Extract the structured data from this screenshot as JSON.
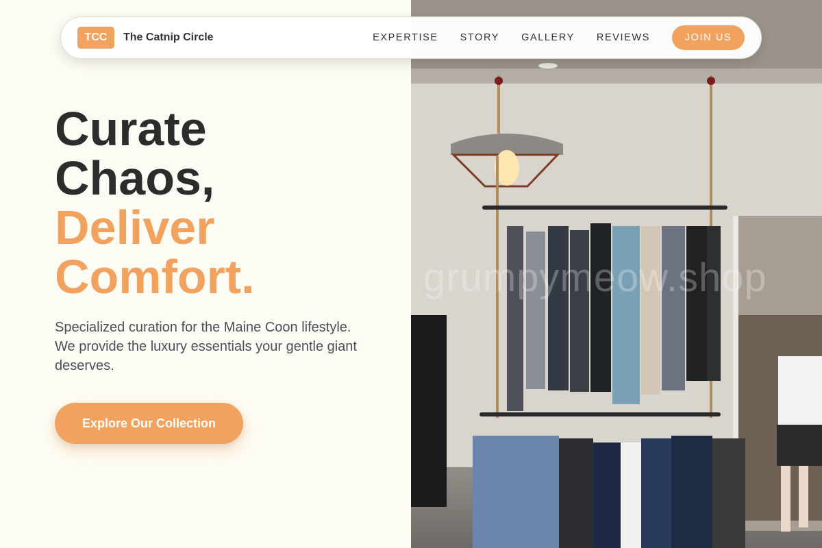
{
  "brand": {
    "badge": "TCC",
    "name": "The Catnip Circle"
  },
  "nav": {
    "links": [
      "EXPERTISE",
      "STORY",
      "GALLERY",
      "REVIEWS"
    ],
    "cta": "JOIN US"
  },
  "hero": {
    "headline_lines": [
      "Curate",
      "Chaos,"
    ],
    "headline_accent_lines": [
      "Deliver",
      "Comfort."
    ],
    "subtitle": "Specialized curation for the Maine Coon lifestyle. We provide the luxury essentials your gentle giant deserves.",
    "cta": "Explore Our Collection",
    "image_watermark": "grumpymeow.shop"
  },
  "colors": {
    "accent": "#f0a25e",
    "background": "#fdfcf4",
    "text_dark": "#2c2c2c",
    "text_muted": "#4b4f58"
  }
}
